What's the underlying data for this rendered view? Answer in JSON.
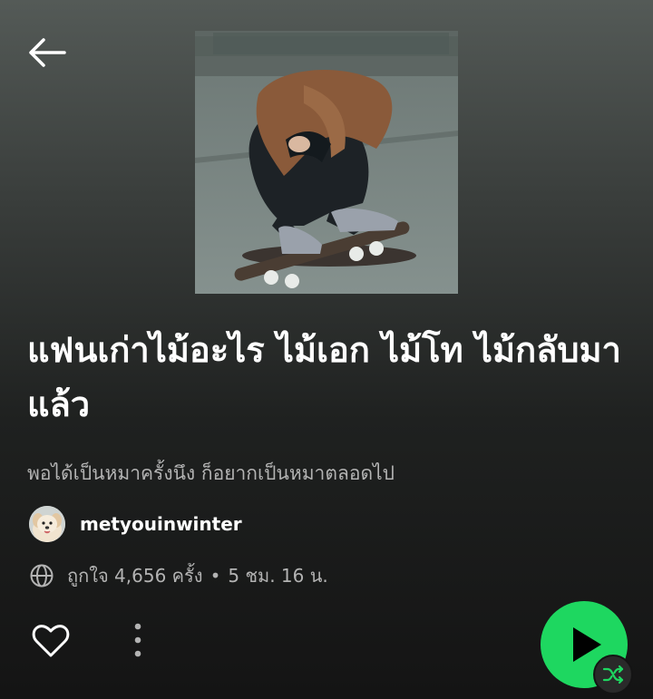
{
  "playlist": {
    "title": "แฟนเก่าไม้อะไร ไม้เอก ไม้โท ไม้กลับมาแล้ว",
    "description": "พอได้เป็นหมาครั้งนึง ก็อยากเป็นหมาตลอดไป",
    "owner": "metyouinwinter",
    "likes_text": "ถูกใจ 4,656 ครั้ง",
    "separator": "•",
    "duration_text": "5 ชม. 16 น."
  },
  "icons": {
    "back": "arrow-left-icon",
    "globe": "globe-icon",
    "like": "heart-outline-icon",
    "more": "more-vertical-icon",
    "play": "play-icon",
    "shuffle": "shuffle-icon"
  },
  "colors": {
    "accent": "#1ed760",
    "secondary_text": "#b3b3b3",
    "shuffle_icon": "#1ed760"
  }
}
